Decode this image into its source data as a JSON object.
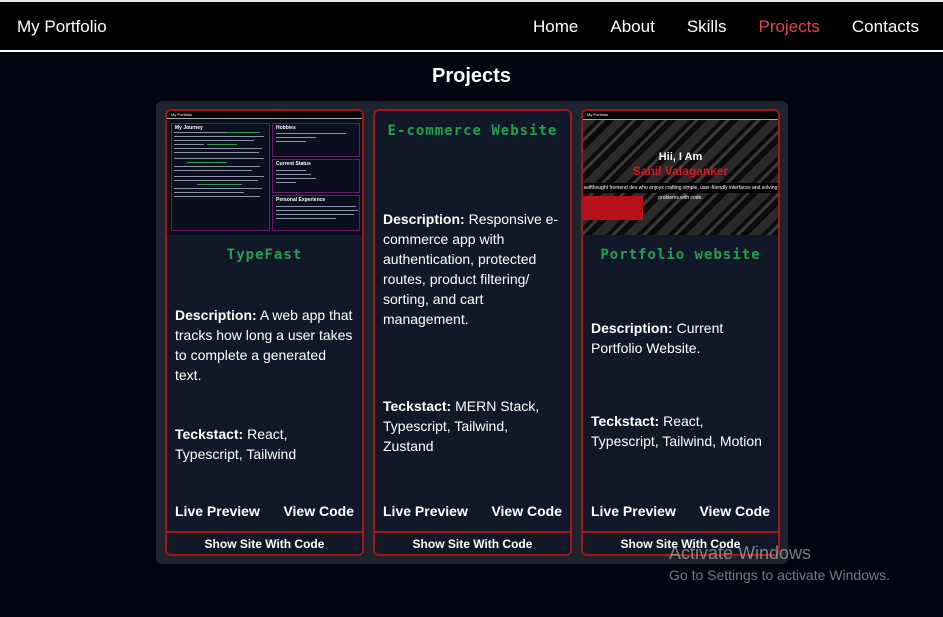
{
  "nav": {
    "brand": "My Portfolio",
    "links": [
      "Home",
      "About",
      "Skills",
      "Projects",
      "Contacts"
    ],
    "active": "Projects",
    "active_color": "#e8434b"
  },
  "section_title": "Projects",
  "projects": [
    {
      "title": "TypeFast",
      "description_label": "Description:",
      "description": "A web app that tracks how long a user takes to complete a generated text.",
      "stack_label": "Teckstact:",
      "stack": "React, Typescript, Tailwind",
      "live_preview": "Live Preview",
      "view_code": "View Code",
      "show_site": "Show Site With Code",
      "thumbnail": {
        "nav_brand": "My Portfolio",
        "journey_heading": "My Journey",
        "hobbies_heading": "Hobbies",
        "status_heading": "Current Status",
        "experience_heading": "Personal Experience"
      }
    },
    {
      "title": "E-commerce Website",
      "description_label": "Description:",
      "description": "Responsive e-commerce app with authentication, protected routes, product filtering/ sorting, and cart management.",
      "stack_label": "Teckstact:",
      "stack": "MERN Stack, Typescript, Tailwind, Zustand",
      "live_preview": "Live Preview",
      "view_code": "View Code",
      "show_site": "Show Site With Code"
    },
    {
      "title": "Portfolio website",
      "description_label": "Description:",
      "description": "Current Portfolio Website.",
      "stack_label": "Teckstact:",
      "stack": "React, Typescript, Tailwind, Motion",
      "live_preview": "Live Preview",
      "view_code": "View Code",
      "show_site": "Show Site With Code",
      "thumbnail": {
        "nav_brand": "My Portfolio",
        "greeting": "Hii, I Am",
        "name": "Sahil Valaganker",
        "tagline": "selfthought frontend dev who enjoys crafting simple, user-friendly interfaces and solving problems with code."
      }
    }
  ],
  "watermark": {
    "line1": "Activate Windows",
    "line2": "Go to Settings to activate Windows."
  },
  "colors": {
    "title_green": "#23a14c",
    "card_border": "#a3151c",
    "card_bg": "#111827",
    "panel_bg": "#1f232b",
    "page_bg": "#02040f"
  }
}
